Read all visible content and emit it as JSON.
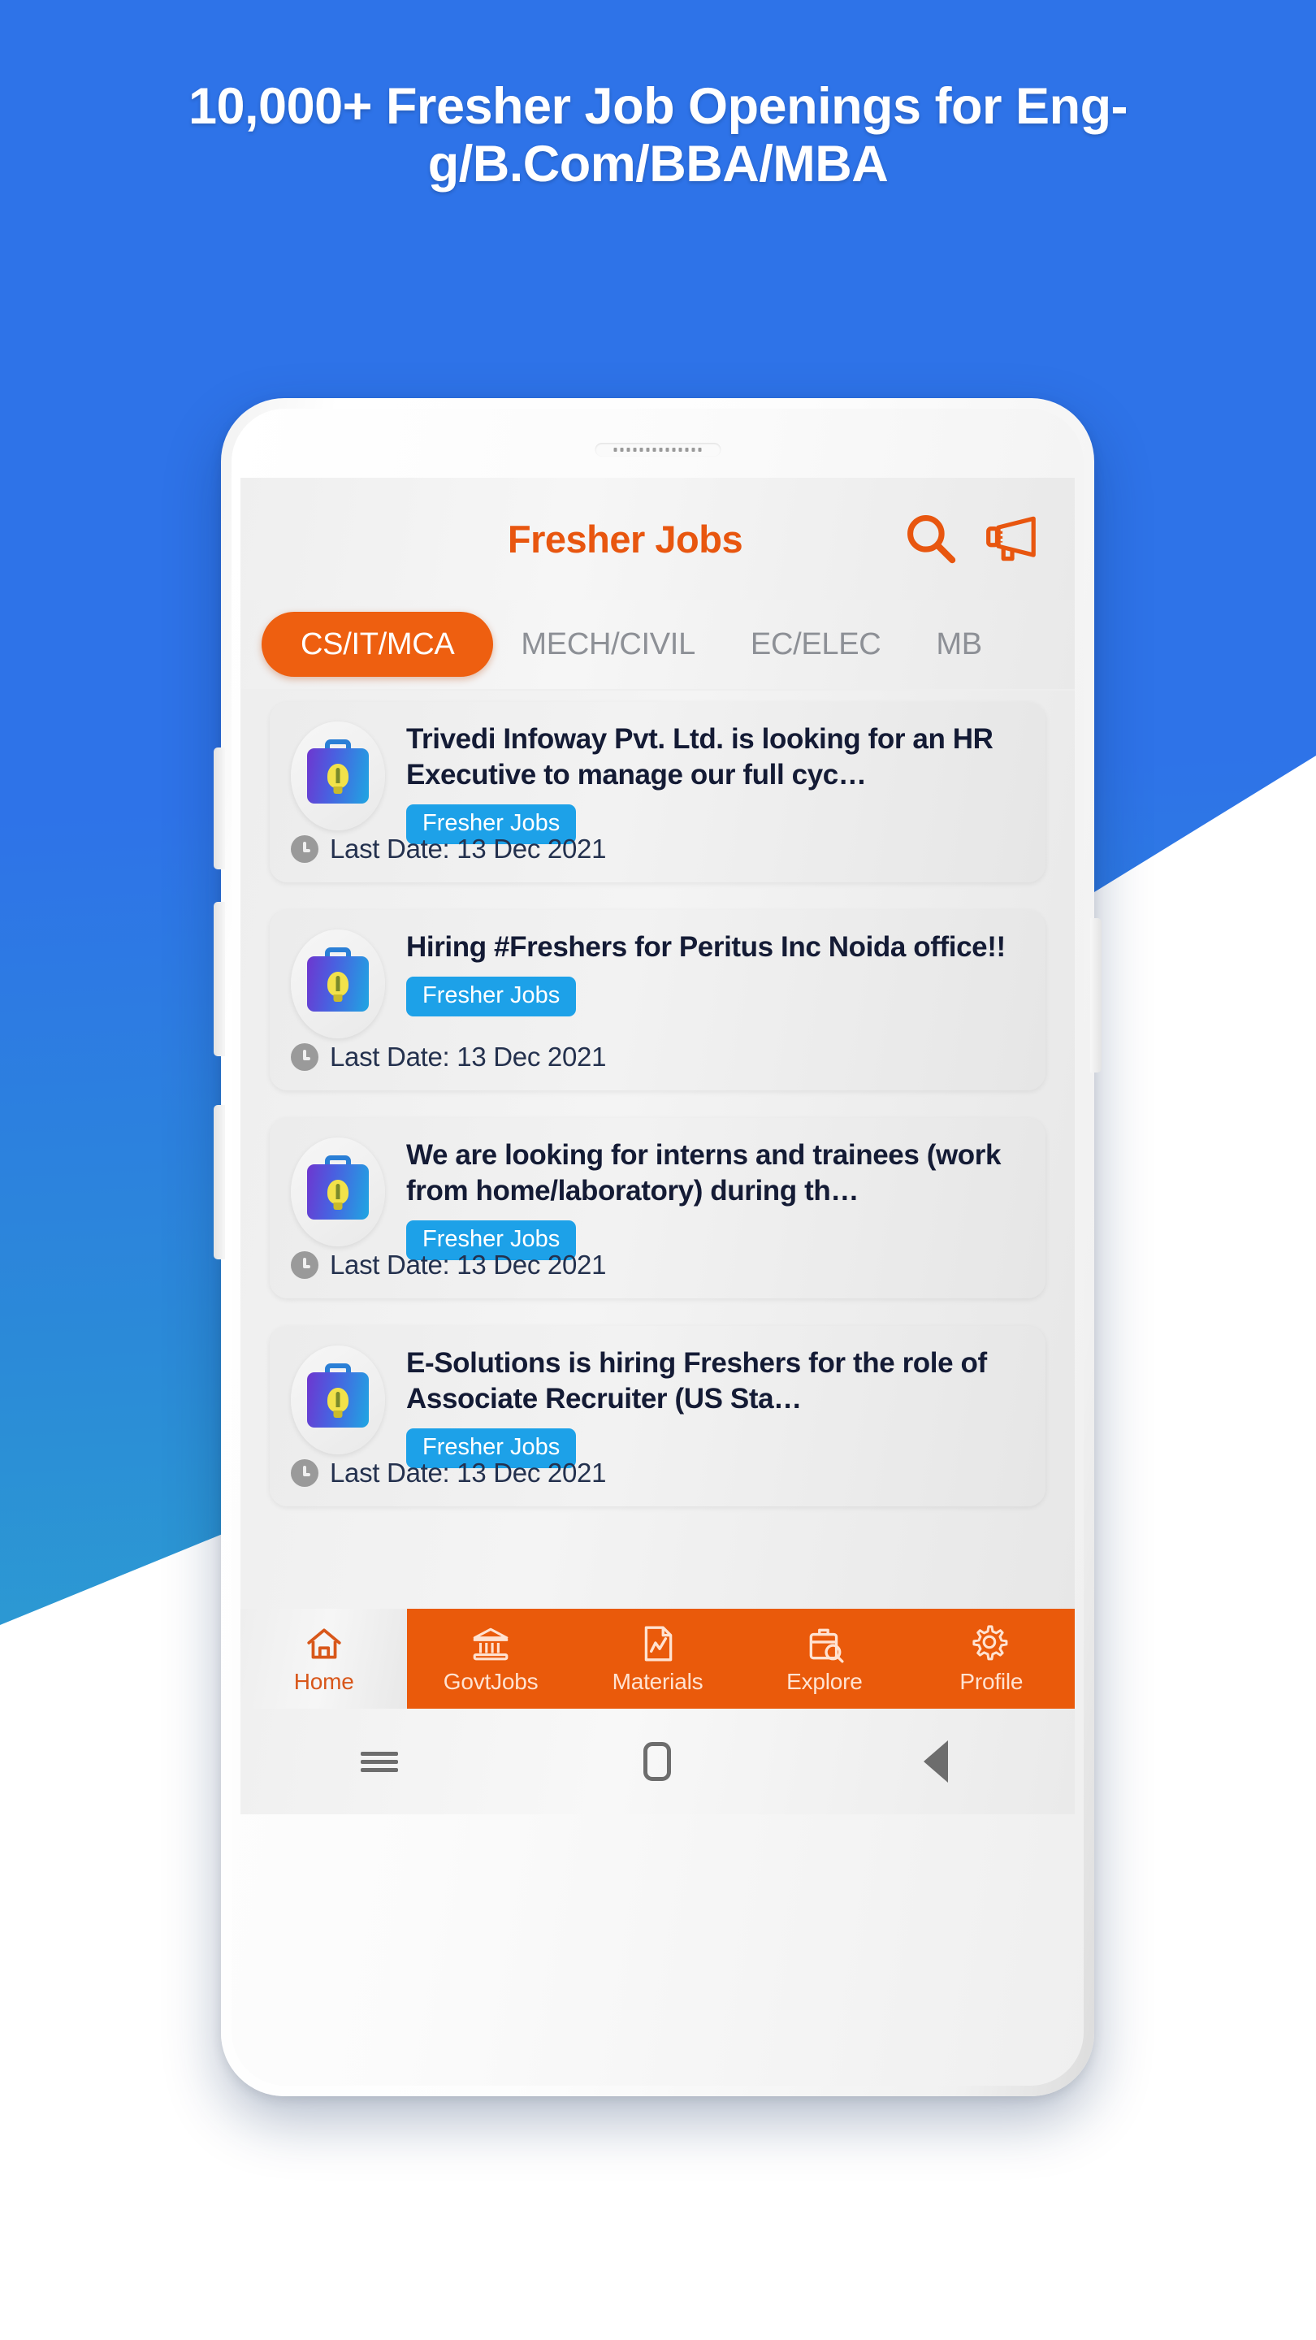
{
  "promo": {
    "headline_line1": "10,000+ Fresher Job Openings for Eng-",
    "headline_line2": "g/B.Com/BBA/MBA",
    "bg_blue": "#2e73e8",
    "bg_cyan": "#2ca6ce",
    "accent_orange": "#ea5a0b",
    "tag_blue": "#1da1e8"
  },
  "app": {
    "header": {
      "title": "Fresher Jobs",
      "search_icon": "search-icon",
      "announcement_icon": "megaphone-icon"
    },
    "tabs": [
      {
        "label": "CS/IT/MCA",
        "active": true
      },
      {
        "label": "MECH/CIVIL",
        "active": false
      },
      {
        "label": "EC/ELEC",
        "active": false
      },
      {
        "label": "MB",
        "active": false
      }
    ],
    "jobs": [
      {
        "title": "Trivedi Infoway Pvt. Ltd. is looking for an HR Executive to manage our full cyc…",
        "tag": "Fresher Jobs",
        "date": "Last Date: 13 Dec 2021",
        "icon": "briefcase-bulb-icon"
      },
      {
        "title": "Hiring #Freshers for Peritus Inc Noida office!!",
        "tag": "Fresher Jobs",
        "date": "Last Date: 13 Dec 2021",
        "icon": "briefcase-bulb-icon"
      },
      {
        "title": "We are looking for interns and trainees (work from home/laboratory) during th…",
        "tag": "Fresher Jobs",
        "date": "Last Date: 13 Dec 2021",
        "icon": "briefcase-bulb-icon"
      },
      {
        "title": "E-Solutions is hiring Freshers for the role of Associate Recruiter (US Sta…",
        "tag": "Fresher Jobs",
        "date": "Last Date: 13 Dec 2021",
        "icon": "briefcase-bulb-icon"
      }
    ],
    "bottom_nav": [
      {
        "label": "Home",
        "icon": "home-icon",
        "active": true
      },
      {
        "label": "GovtJobs",
        "icon": "bank-icon",
        "active": false
      },
      {
        "label": "Materials",
        "icon": "document-chart-icon",
        "active": false
      },
      {
        "label": "Explore",
        "icon": "briefcase-search-icon",
        "active": false
      },
      {
        "label": "Profile",
        "icon": "gear-icon",
        "active": false
      }
    ]
  },
  "system_nav": {
    "recents": "recents-icon",
    "home": "home-square-icon",
    "back": "back-triangle-icon"
  }
}
